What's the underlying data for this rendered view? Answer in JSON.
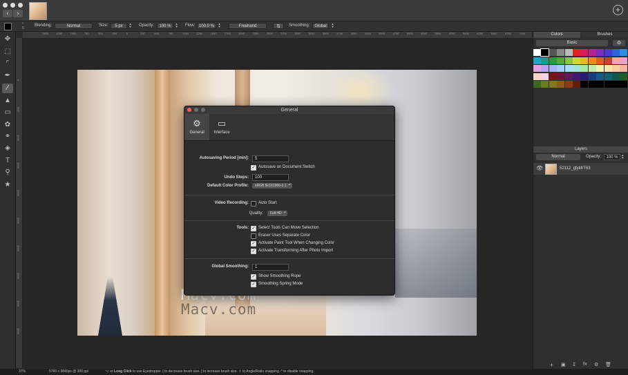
{
  "window": {
    "add_icon": "plus-circle-icon"
  },
  "options": {
    "blending_label": "Blending:",
    "blending_value": "Normal",
    "size_label": "Size:",
    "size_value": "5 px",
    "opacity_label": "Opacity:",
    "opacity_value": "100 %",
    "flow_label": "Flow:",
    "flow_value": "100.0 %",
    "mode_value": "Freehand",
    "smoothing_label": "Smoothing:",
    "smoothing_value": "Global"
  },
  "ruler_top": [
    "1500",
    "1250",
    "1000",
    "750",
    "500",
    "250",
    "0",
    "250",
    "500",
    "750",
    "1000",
    "1250",
    "1500",
    "1750",
    "2000",
    "2250",
    "2500",
    "2750",
    "3000",
    "3250",
    "3500",
    "3750",
    "4000",
    "4250",
    "4500",
    "4750",
    "5000",
    "5250",
    "5500",
    "5750",
    "6000",
    "6250",
    "6500",
    "6750",
    "7000",
    "7250"
  ],
  "ruler_left": [
    "0",
    "500",
    "1000",
    "1500",
    "2000",
    "2500",
    "3000",
    "3500",
    "4000",
    "4500"
  ],
  "dialog": {
    "title": "General",
    "tabs": [
      {
        "label": "General",
        "icon": "gear-icon"
      },
      {
        "label": "Interface",
        "icon": "monitor-icon"
      }
    ],
    "autosave_period_label": "Autosaving Period [min]:",
    "autosave_period_value": "5",
    "autosave_switch_label": "Autosave on Document Switch",
    "undo_steps_label": "Undo Steps:",
    "undo_steps_value": "100",
    "color_profile_label": "Default Color Profile:",
    "color_profile_value": "sRGB IEC61966-2.1",
    "video_recording_label": "Video Recording:",
    "auto_start_label": "Auto Start",
    "quality_label": "Quality:",
    "quality_value": "Full HD",
    "tools_label": "Tools:",
    "tool_options": [
      {
        "label": "Select Tools Can Move Selection",
        "checked": true
      },
      {
        "label": "Eraser Uses Separate Color",
        "checked": false
      },
      {
        "label": "Activate Paint Tool When Changing Color",
        "checked": true
      },
      {
        "label": "Activate Transforming After Photo Import",
        "checked": true
      }
    ],
    "global_smoothing_label": "Global Smoothing:",
    "global_smoothing_value": "1",
    "smoothing_options": [
      {
        "label": "Show Smoothing Rope",
        "checked": true
      },
      {
        "label": "Smoothing Spring Mode",
        "checked": true
      }
    ]
  },
  "watermark": {
    "text": "Macv.com"
  },
  "right_panel": {
    "tab_colors": "Colors",
    "tab_brushes": "Brushes",
    "palette_value": "Basic",
    "swatches": [
      "#ffffff",
      "#000000",
      "#555555",
      "#888888",
      "#bbbbbb",
      "#e02424",
      "#d81b60",
      "#b4238f",
      "#7b2fbf",
      "#4a3ad1",
      "#3163d8",
      "#2b8ee0",
      "#1fa5c8",
      "#1f9a8a",
      "#2a9a3f",
      "#57a63a",
      "#8ac53b",
      "#d6d630",
      "#e9b92a",
      "#ef8a21",
      "#ea5a23",
      "#c8432a",
      "#ffa5a5",
      "#f7a3c7",
      "#e4a1e4",
      "#bca1f0",
      "#a7b4f4",
      "#a4cdf5",
      "#a2e1f2",
      "#9fe6d7",
      "#a8e6a8",
      "#c8ebad",
      "#eef2b0",
      "#f7e4ad",
      "#f7cf9f",
      "#f4b49d",
      "#fcd5c4",
      "#f7d3e3",
      "#7d1212",
      "#7a0e3a",
      "#63155d",
      "#3f1870",
      "#261d77",
      "#173c80",
      "#135a84",
      "#116170",
      "#0f5a4a",
      "#1c5e27",
      "#3a6a21",
      "#6a7d1c",
      "#86761a",
      "#8c5a15",
      "#8a3b12",
      "#5e1f0c",
      "#000000",
      "#000000",
      "#000000",
      "#000000",
      "#000000",
      "#000000"
    ],
    "layers_header": "Layers",
    "layer_blend_value": "Normal",
    "layer_opacity_label": "Opacity:",
    "layer_opacity_value": "100 %",
    "layer_name": "52112_gfykfrT63"
  },
  "status": {
    "zoom": "37%",
    "doc_info": "5760 x 3840px @ 300 ppi",
    "hint_pre": "⌥ or",
    "hint_bold": "Long Click",
    "hint_post": "to use Eyedropper.  [ to decrease brush size.  ] to increase brush size.  ⇧ to Angle/Ratio snapping.  ^ to disable snapping."
  }
}
